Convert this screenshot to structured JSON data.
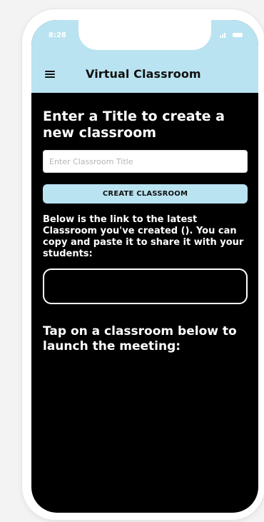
{
  "status": {
    "time": "8:28",
    "signal_text": ".ıl"
  },
  "header": {
    "title": "Virtual Classroom"
  },
  "main": {
    "prompt": "Enter a Title to create a new classroom",
    "input_placeholder": "Enter Classroom Title",
    "input_value": "",
    "create_button_label": "CREATE CLASSROOM",
    "link_description": "Below is the link to the latest Classroom you've created (). You can copy and paste it to share it with your students:",
    "link_value": "",
    "tap_prompt": "Tap on a classroom below to launch the meeting:"
  },
  "colors": {
    "accent": "#b9e3f1",
    "screen_bg": "#000000",
    "text_light": "#ffffff"
  },
  "icons": {
    "menu": "menu-icon",
    "signal": "signal-icon",
    "battery": "battery-icon"
  }
}
